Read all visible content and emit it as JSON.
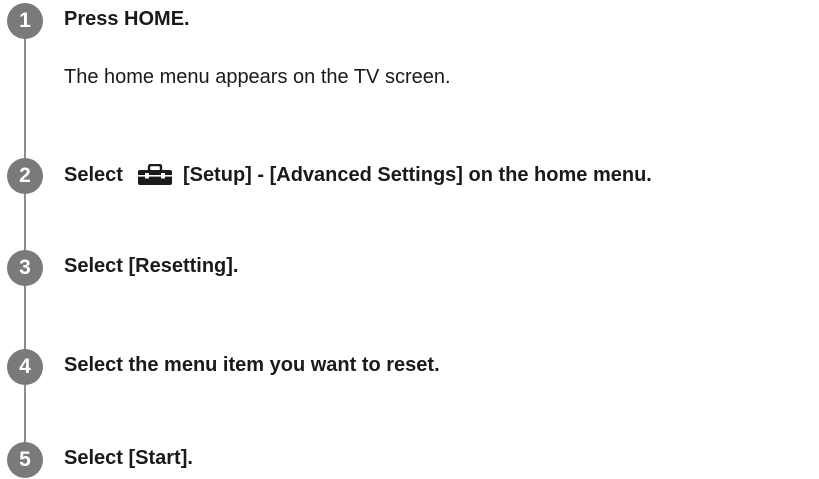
{
  "steps": [
    {
      "number": "1",
      "title": "Press HOME.",
      "description": "The home menu appears on the TV screen."
    },
    {
      "number": "2",
      "title_prefix": "Select",
      "icon": "toolbox-icon",
      "title_suffix": "[Setup] - [Advanced Settings] on the home menu."
    },
    {
      "number": "3",
      "title": "Select [Resetting]."
    },
    {
      "number": "4",
      "title": "Select the menu item you want to reset."
    },
    {
      "number": "5",
      "title": "Select [Start]."
    }
  ],
  "colors": {
    "badge": "#7a7a7a",
    "line": "#8c8c8c",
    "text": "#1a1a1a"
  }
}
